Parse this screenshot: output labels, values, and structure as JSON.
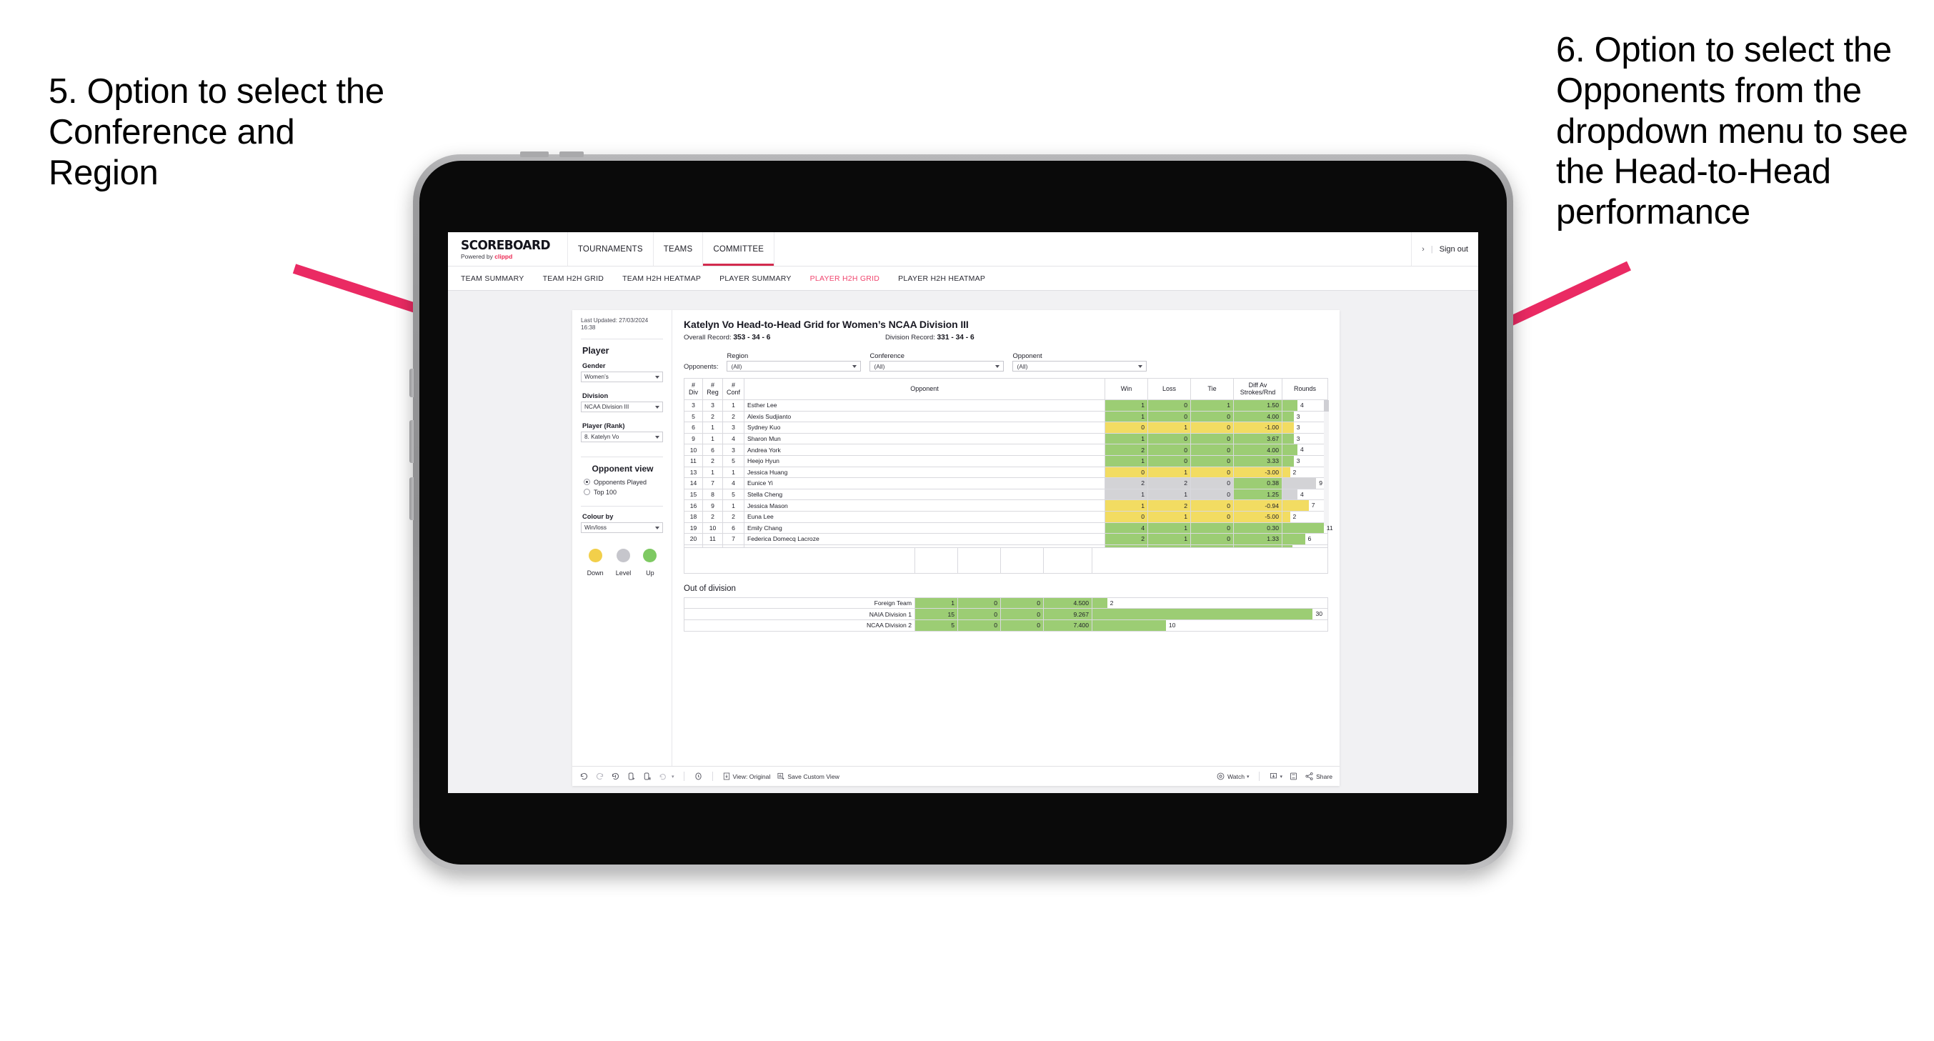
{
  "annotations": {
    "left": "5. Option to select the Conference and Region",
    "right": "6. Option to select the Opponents from the dropdown menu to see the Head-to-Head performance",
    "arrow_color": "#ea2a63"
  },
  "topnav": {
    "brand_name": "SCOREBOARD",
    "brand_sub_prefix": "Powered by ",
    "brand_sub_accent": "clippd",
    "items": [
      {
        "label": "TOURNAMENTS",
        "active": false
      },
      {
        "label": "TEAMS",
        "active": false
      },
      {
        "label": "COMMITTEE",
        "active": true
      }
    ],
    "chevron": "›",
    "separator": "|",
    "signout": "Sign out"
  },
  "subnav": {
    "tabs": [
      {
        "label": "TEAM SUMMARY",
        "active": false
      },
      {
        "label": "TEAM H2H GRID",
        "active": false
      },
      {
        "label": "TEAM H2H HEATMAP",
        "active": false
      },
      {
        "label": "PLAYER SUMMARY",
        "active": false
      },
      {
        "label": "PLAYER H2H GRID",
        "active": true
      },
      {
        "label": "PLAYER H2H HEATMAP",
        "active": false
      }
    ],
    "active_color": "#f0456e"
  },
  "sidebar": {
    "last_updated": "Last Updated: 27/03/2024 16:38",
    "player_section_title": "Player",
    "gender_label": "Gender",
    "gender_value": "Women’s",
    "division_label": "Division",
    "division_value": "NCAA Division III",
    "player_rank_label": "Player (Rank)",
    "player_rank_value": "8. Katelyn Vo",
    "opponent_view_title": "Opponent view",
    "opponent_view_options": [
      {
        "label": "Opponents Played",
        "selected": true
      },
      {
        "label": "Top 100",
        "selected": false
      }
    ],
    "colour_by_label": "Colour by",
    "colour_by_value": "Win/loss",
    "legend": [
      {
        "label": "Down",
        "color": "#f2cf4a"
      },
      {
        "label": "Level",
        "color": "#c6c6cc"
      },
      {
        "label": "Up",
        "color": "#7ec962"
      }
    ]
  },
  "main": {
    "title": "Katelyn Vo Head-to-Head Grid for Women’s NCAA Division III",
    "overall_record_label": "Overall Record: ",
    "overall_record_value": "353 - 34 - 6",
    "division_record_label": "Division Record: ",
    "division_record_value": "331 - 34 - 6",
    "opponents_label": "Opponents:",
    "filters": [
      {
        "label": "Region",
        "value": "(All)"
      },
      {
        "label": "Conference",
        "value": "(All)"
      },
      {
        "label": "Opponent",
        "value": "(All)"
      }
    ],
    "out_of_division_title": "Out of division"
  },
  "chart_data": {
    "type": "table",
    "title": "Katelyn Vo Head-to-Head Grid for Women’s NCAA Division III",
    "columns": [
      "# Div",
      "# Reg",
      "# Conf",
      "Opponent",
      "Win",
      "Loss",
      "Tie",
      "Diff Av Strokes/Rnd",
      "Rounds"
    ],
    "colors": {
      "up": "#9ccd74",
      "down": "#f2dc62",
      "level": "#d3d3d6"
    },
    "rounds_max": 12,
    "rows": [
      {
        "div": "3",
        "reg": "3",
        "conf": "1",
        "opponent": "Esther Lee",
        "win": "1",
        "loss": "0",
        "tie": "1",
        "diff": "1.50",
        "rounds": "4",
        "state": "up"
      },
      {
        "div": "5",
        "reg": "2",
        "conf": "2",
        "opponent": "Alexis Sudjianto",
        "win": "1",
        "loss": "0",
        "tie": "0",
        "diff": "4.00",
        "rounds": "3",
        "state": "up"
      },
      {
        "div": "6",
        "reg": "1",
        "conf": "3",
        "opponent": "Sydney Kuo",
        "win": "0",
        "loss": "1",
        "tie": "0",
        "diff": "-1.00",
        "rounds": "3",
        "state": "down"
      },
      {
        "div": "9",
        "reg": "1",
        "conf": "4",
        "opponent": "Sharon Mun",
        "win": "1",
        "loss": "0",
        "tie": "0",
        "diff": "3.67",
        "rounds": "3",
        "state": "up"
      },
      {
        "div": "10",
        "reg": "6",
        "conf": "3",
        "opponent": "Andrea York",
        "win": "2",
        "loss": "0",
        "tie": "0",
        "diff": "4.00",
        "rounds": "4",
        "state": "up"
      },
      {
        "div": "11",
        "reg": "2",
        "conf": "5",
        "opponent": "Heejo Hyun",
        "win": "1",
        "loss": "0",
        "tie": "0",
        "diff": "3.33",
        "rounds": "3",
        "state": "up"
      },
      {
        "div": "13",
        "reg": "1",
        "conf": "1",
        "opponent": "Jessica Huang",
        "win": "0",
        "loss": "1",
        "tie": "0",
        "diff": "-3.00",
        "rounds": "2",
        "state": "down"
      },
      {
        "div": "14",
        "reg": "7",
        "conf": "4",
        "opponent": "Eunice Yi",
        "win": "2",
        "loss": "2",
        "tie": "0",
        "diff": "0.38",
        "rounds": "9",
        "state": "level",
        "diff_state": "up"
      },
      {
        "div": "15",
        "reg": "8",
        "conf": "5",
        "opponent": "Stella Cheng",
        "win": "1",
        "loss": "1",
        "tie": "0",
        "diff": "1.25",
        "rounds": "4",
        "state": "level",
        "diff_state": "up"
      },
      {
        "div": "16",
        "reg": "9",
        "conf": "1",
        "opponent": "Jessica Mason",
        "win": "1",
        "loss": "2",
        "tie": "0",
        "diff": "-0.94",
        "rounds": "7",
        "state": "down"
      },
      {
        "div": "18",
        "reg": "2",
        "conf": "2",
        "opponent": "Euna Lee",
        "win": "0",
        "loss": "1",
        "tie": "0",
        "diff": "-5.00",
        "rounds": "2",
        "state": "down"
      },
      {
        "div": "19",
        "reg": "10",
        "conf": "6",
        "opponent": "Emily Chang",
        "win": "4",
        "loss": "1",
        "tie": "0",
        "diff": "0.30",
        "rounds": "11",
        "state": "up"
      },
      {
        "div": "20",
        "reg": "11",
        "conf": "7",
        "opponent": "Federica Domecq Lacroze",
        "win": "2",
        "loss": "1",
        "tie": "0",
        "diff": "1.33",
        "rounds": "6",
        "state": "up"
      }
    ],
    "out_of_division": {
      "rounds_max": 32,
      "rows": [
        {
          "name": "Foreign Team",
          "win": "1",
          "loss": "0",
          "tie": "0",
          "diff": "4.500",
          "rounds": "2",
          "state": "up"
        },
        {
          "name": "NAIA Division 1",
          "win": "15",
          "loss": "0",
          "tie": "0",
          "diff": "9.267",
          "rounds": "30",
          "state": "up"
        },
        {
          "name": "NCAA Division 2",
          "win": "5",
          "loss": "0",
          "tie": "0",
          "diff": "7.400",
          "rounds": "10",
          "state": "up"
        }
      ]
    }
  },
  "toolbar": {
    "items": [
      {
        "name": "undo-icon",
        "label": ""
      },
      {
        "name": "redo-icon",
        "label": ""
      },
      {
        "name": "revert-icon",
        "label": ""
      },
      {
        "name": "refresh-data-icon",
        "label": ""
      },
      {
        "name": "pause-refresh-icon",
        "label": ""
      },
      {
        "name": "alerts-icon",
        "label": ""
      }
    ],
    "view_label": "View: Original",
    "save_custom_view_label": "Save Custom View",
    "watch_label": "Watch",
    "share_label": "Share"
  }
}
